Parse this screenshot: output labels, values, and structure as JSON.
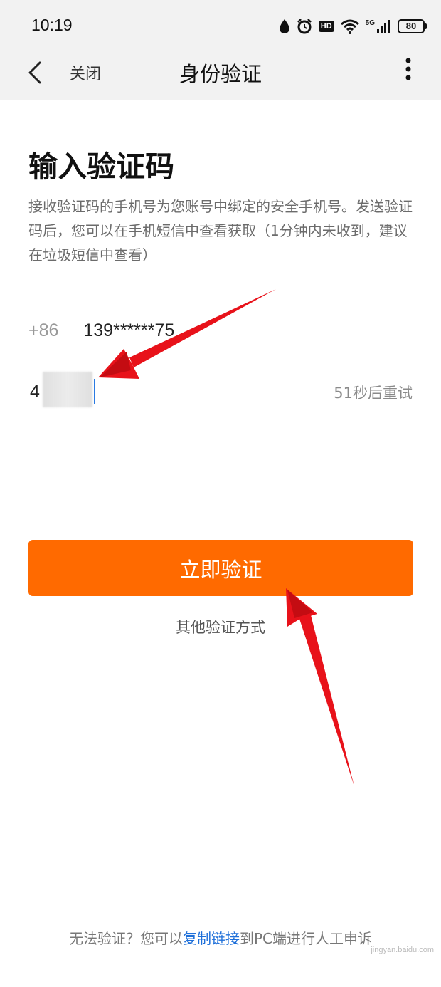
{
  "status": {
    "time": "10:19",
    "hd_label": "HD",
    "network_label": "5G",
    "battery_level": "80"
  },
  "nav": {
    "close_label": "关闭",
    "title": "身份验证"
  },
  "content": {
    "heading": "输入验证码",
    "description": "接收验证码的手机号为您账号中绑定的安全手机号。发送验证码后，您可以在手机短信中查看获取（1分钟内未收到，建议在垃圾短信中查看）",
    "country_code": "+86",
    "phone_number": "139******75",
    "code_value": "4",
    "retry_label": "51秒后重试",
    "verify_label": "立即验证",
    "other_methods_label": "其他验证方式"
  },
  "footer": {
    "prefix": "无法验证？您可以",
    "link": "复制链接",
    "suffix": "到PC端进行人工申诉"
  },
  "watermark": {
    "text": "jingyan.baidu.com"
  },
  "colors": {
    "accent": "#ff6a00",
    "link": "#1e6fd9",
    "arrow": "#e8121a"
  }
}
